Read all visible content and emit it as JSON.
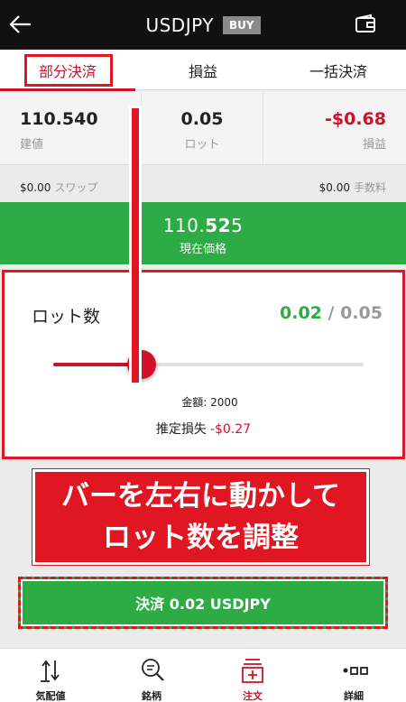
{
  "header": {
    "title": "USDJPY",
    "badge": "BUY",
    "back_icon": "arrow-left-icon",
    "wallet_icon": "wallet-icon"
  },
  "tabs": [
    {
      "label": "部分決済",
      "active": true
    },
    {
      "label": "損益",
      "active": false
    },
    {
      "label": "一括決済",
      "active": false
    }
  ],
  "position": {
    "open_price": {
      "value": "110.540",
      "label": "建値"
    },
    "lot": {
      "value": "0.05",
      "label": "ロット"
    },
    "pnl": {
      "value": "-$0.68",
      "label": "損益"
    }
  },
  "fees": {
    "swap_value": "$0.00",
    "swap_label": "スワップ",
    "commission_value": "$0.00",
    "commission_label": "手数料"
  },
  "current_price": {
    "prefix": "110.",
    "bold": "52",
    "suffix": "5",
    "label": "現在価格"
  },
  "lot_selector": {
    "title": "ロット数",
    "current": "0.02",
    "separator": " / ",
    "max": "0.05",
    "level_fraction": 0.4,
    "amount_label": "金額:",
    "amount_value": "2000",
    "estimate_label": "推定損失",
    "estimate_value": "-$0.27"
  },
  "annotation": {
    "line1": "バーを左右に動かして",
    "line2": "ロット数を調整"
  },
  "settle_button": {
    "label": "決済 0.02 USDJPY"
  },
  "bottom_nav": [
    {
      "label": "気配値",
      "icon": "quotes-arrows-icon",
      "active": false
    },
    {
      "label": "銘柄",
      "icon": "search-symbol-icon",
      "active": false
    },
    {
      "label": "注文",
      "icon": "order-icon",
      "active": true
    },
    {
      "label": "詳細",
      "icon": "details-dots-icon",
      "active": false
    }
  ],
  "colors": {
    "accent_red": "#d0112b",
    "green": "#2dab44",
    "header_bg": "#111111"
  }
}
